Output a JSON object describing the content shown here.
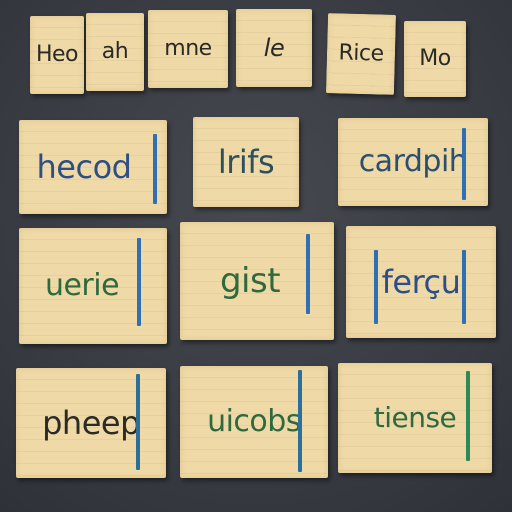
{
  "cards": {
    "row1": [
      {
        "text": "Heo",
        "color": "#2a2a26"
      },
      {
        "text": "ah",
        "color": "#2a2a26"
      },
      {
        "text": "mne",
        "color": "#2a2a26"
      },
      {
        "text": "le",
        "color": "#2a2a26"
      },
      {
        "text": "Rice",
        "color": "#2a2a26"
      },
      {
        "text": "Mo",
        "color": "#2a2a26"
      }
    ],
    "row2": [
      {
        "text": "hecod",
        "color": "#2d4f86"
      },
      {
        "text": "lrifs",
        "color": "#2d4f5e"
      },
      {
        "text": "cardpih",
        "color": "#2d4f6e"
      }
    ],
    "row3": [
      {
        "text": "uerie",
        "color": "#2f6a3e"
      },
      {
        "text": "gist",
        "color": "#2f6a3e"
      },
      {
        "text": "ferçu",
        "color": "#2d4f86"
      }
    ],
    "row4": [
      {
        "text": "pheep",
        "color": "#2a2a26"
      },
      {
        "text": "uicobs",
        "color": "#2f6a3e"
      },
      {
        "text": "tiense",
        "color": "#2f6a3e"
      }
    ]
  },
  "colors": {
    "board": "#3c4046",
    "card": "#efd9a6",
    "blue_ink": "#2f6fb3",
    "green_ink": "#2d8a55"
  }
}
